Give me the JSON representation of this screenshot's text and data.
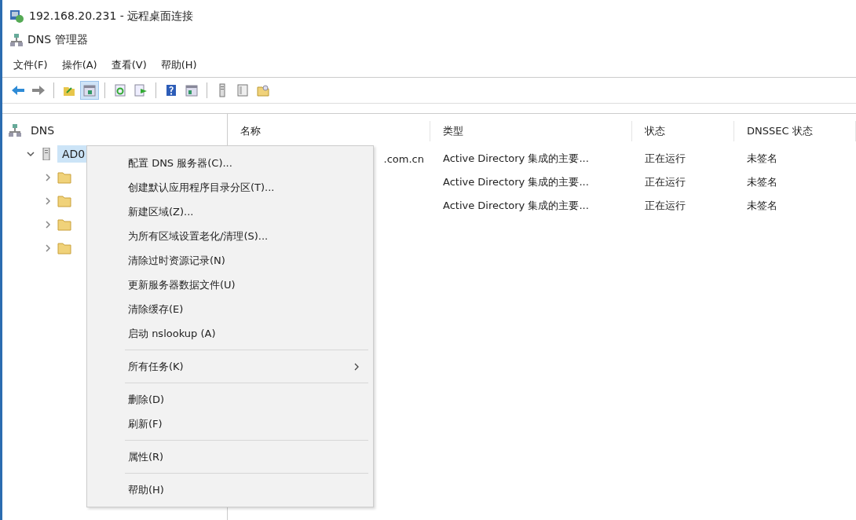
{
  "remote_window": {
    "title": "192.168.20.231 - 远程桌面连接"
  },
  "window": {
    "title": "DNS 管理器"
  },
  "menu_bar": [
    "文件(F)",
    "操作(A)",
    "查看(V)",
    "帮助(H)"
  ],
  "toolbar": {
    "groups": [
      [
        {
          "selected": false
        },
        {
          "selected": false
        }
      ],
      [
        {
          "selected": false
        },
        {
          "selected": true
        }
      ],
      [
        {
          "selected": false
        },
        {
          "selected": false
        }
      ],
      [
        {
          "selected": false
        },
        {
          "selected": false
        }
      ],
      [
        {
          "selected": false
        },
        {
          "selected": false
        },
        {
          "selected": false
        }
      ]
    ]
  },
  "tree": [
    {
      "label": "DNS",
      "selected": false,
      "children": [
        {
          "label": "AD0",
          "expanded": true,
          "selected": true,
          "children": [
            {
              "expanded": false
            },
            {
              "expanded": false
            },
            {
              "expanded": false
            },
            {
              "expanded": false
            }
          ]
        }
      ]
    }
  ],
  "table": {
    "columns": [
      "名称",
      "类型",
      "状态",
      "DNSSEC 状态"
    ],
    "rows": [
      {
        "name": ".com.cn",
        "type": "Active Directory 集成的主要...",
        "status": "正在运行",
        "dnssec": "未签名"
      },
      {
        "type": "Active Directory 集成的主要...",
        "status": "正在运行",
        "dnssec": "未签名"
      },
      {
        "type": "Active Directory 集成的主要...",
        "status": "正在运行",
        "dnssec": "未签名"
      }
    ]
  },
  "context_menu": {
    "items": [
      {
        "kind": "item",
        "label": "配置 DNS 服务器(C)..."
      },
      {
        "kind": "item",
        "label": "创建默认应用程序目录分区(T)..."
      },
      {
        "kind": "item",
        "label": "新建区域(Z)..."
      },
      {
        "kind": "item",
        "label": "为所有区域设置老化/清理(S)..."
      },
      {
        "kind": "item",
        "label": "清除过时资源记录(N)"
      },
      {
        "kind": "item",
        "label": "更新服务器数据文件(U)"
      },
      {
        "kind": "item",
        "label": "清除缓存(E)"
      },
      {
        "kind": "item",
        "label": "启动 nslookup (A)"
      },
      {
        "kind": "separator"
      },
      {
        "kind": "submenu",
        "label": "所有任务(K)"
      },
      {
        "kind": "separator"
      },
      {
        "kind": "item",
        "label": "删除(D)"
      },
      {
        "kind": "item",
        "label": "刷新(F)"
      },
      {
        "kind": "separator"
      },
      {
        "kind": "item",
        "label": "属性(R)"
      },
      {
        "kind": "separator"
      },
      {
        "kind": "item",
        "label": "帮助(H)"
      }
    ]
  }
}
